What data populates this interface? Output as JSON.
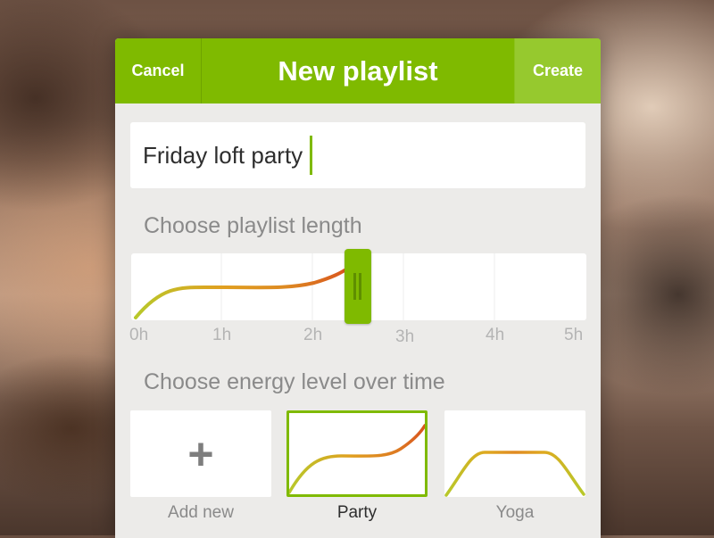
{
  "header": {
    "cancel_label": "Cancel",
    "title": "New playlist",
    "create_label": "Create"
  },
  "playlist_name": {
    "value": "Friday loft party"
  },
  "length_section": {
    "label": "Choose playlist length",
    "ticks": [
      "0h",
      "1h",
      "2h",
      "3h",
      "4h",
      "5h"
    ],
    "selected_hours": 2.5
  },
  "energy_section": {
    "label": "Choose energy level over time",
    "options": [
      {
        "label": "Add new",
        "icon": "plus-icon",
        "selected": false
      },
      {
        "label": "Party",
        "selected": true
      },
      {
        "label": "Yoga",
        "selected": false
      }
    ]
  },
  "colors": {
    "accent": "#7fba00",
    "curve_start": "#b8c82a",
    "curve_mid": "#e0a020",
    "curve_end": "#d9541e"
  }
}
